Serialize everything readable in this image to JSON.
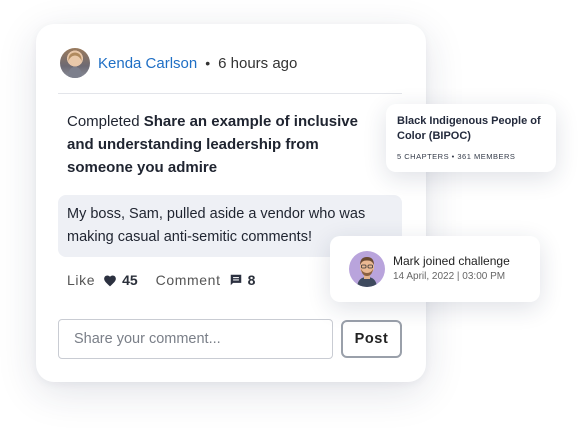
{
  "post": {
    "author": "Kenda Carlson",
    "separator": "•",
    "time": "6 hours ago",
    "completed_prefix": "Completed",
    "challenge_title": "Share an example of inclusive and understanding leadership from someone you admire",
    "quote": "My boss, Sam, pulled aside a vendor who was making casual anti-semitic comments!",
    "like_label": "Like",
    "like_count": "45",
    "comment_label": "Comment",
    "comment_count": "8",
    "comment_placeholder": "Share your comment...",
    "post_label": "Post"
  },
  "group": {
    "title": "Black Indigenous People of Color (BIPOC)",
    "meta": "5 CHAPTERS • 361 MEMBERS"
  },
  "join": {
    "title": "Mark joined challenge",
    "date": "14 April, 2022 | 03:00 PM"
  },
  "colors": {
    "author_link": "#1f6fc5",
    "quote_bg": "#eef0f5",
    "avatar_bg": "#b9a4dc"
  },
  "icons": {
    "like": "heart-icon",
    "comment": "chat-icon"
  }
}
